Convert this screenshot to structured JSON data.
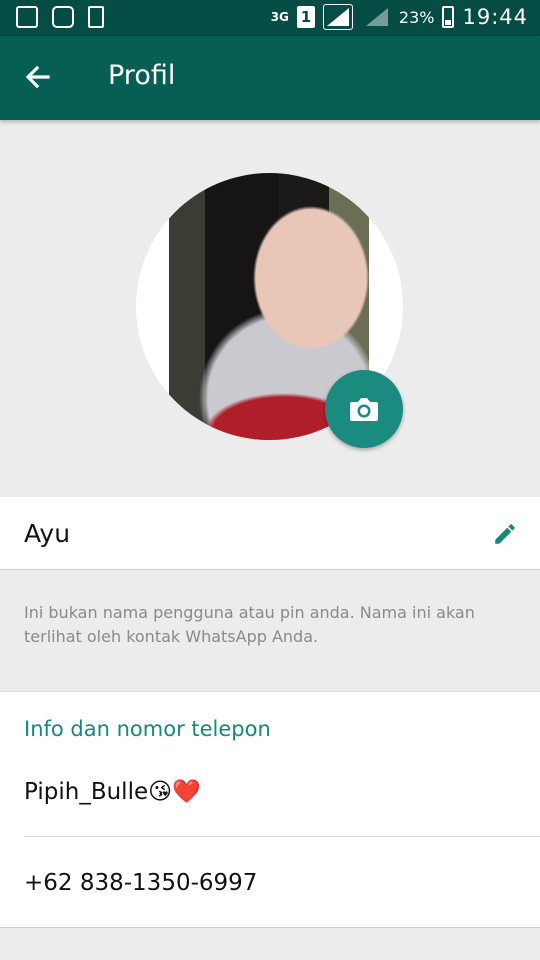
{
  "status_bar": {
    "network": "3G",
    "sim": "1",
    "battery": "23%",
    "time": "19:44"
  },
  "app_bar": {
    "title": "Profil"
  },
  "profile": {
    "name": "Ayu",
    "hint": "Ini bukan nama pengguna atau pin anda. Nama ini akan terlihat oleh kontak WhatsApp Anda."
  },
  "info": {
    "heading": "Info dan nomor telepon",
    "status": "Pipih_Bulle😘❤️",
    "phone": "+62 838-1350-6997"
  },
  "colors": {
    "status_bar": "#054d44",
    "app_bar": "#075e54",
    "accent": "#138a7c"
  },
  "icons": [
    "gallery-icon",
    "bbm-icon",
    "phone-rotate-icon",
    "back-arrow-icon",
    "camera-icon",
    "pencil-icon"
  ]
}
